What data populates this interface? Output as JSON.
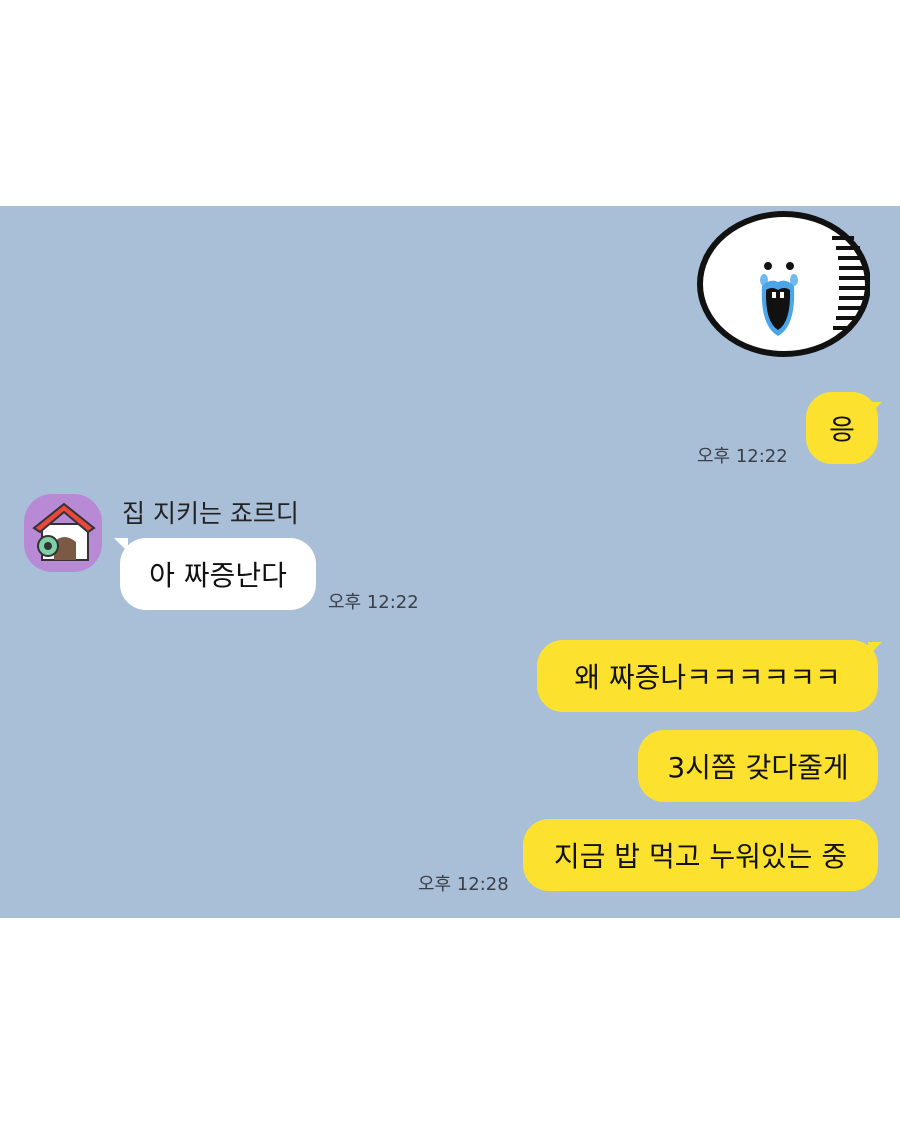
{
  "chat": {
    "sticker": {
      "name": "crying-white-face-sticker"
    },
    "messages": [
      {
        "text": "응",
        "time": "오후 12:22"
      },
      {
        "sender": "집 지키는 죠르디",
        "text": "아 짜증난다",
        "time": "오후 12:22"
      },
      {
        "text": "왜 짜증나ㅋㅋㅋㅋㅋㅋ"
      },
      {
        "text": "3시쯤 갖다줄게"
      },
      {
        "text": "지금 밥 먹고 누워있는 중",
        "time": "오후 12:28"
      }
    ]
  },
  "colors": {
    "chat_background": "#a9bfd8",
    "my_bubble": "#fce22f",
    "their_bubble": "#ffffff",
    "avatar_background": "#b889d4"
  }
}
